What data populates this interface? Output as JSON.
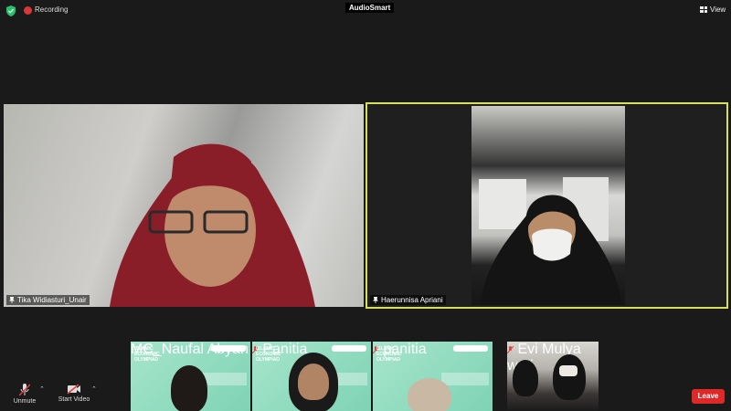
{
  "topbar": {
    "recording_label": "Recording",
    "title": "AudioSmart",
    "view_label": "View"
  },
  "colors": {
    "active_speaker_border": "#d7e05a",
    "recording_dot": "#d93838",
    "leave_button": "#e02828",
    "shield": "#27c26a"
  },
  "participants": {
    "main": [
      {
        "name": "Tika Widiasturi_Unair",
        "muted": false
      },
      {
        "name": "Haerunnisa Apriani",
        "muted": false,
        "active_speaker": true
      }
    ],
    "strip": [
      {
        "name": "MC_Naufal Abyan",
        "muted": false
      },
      {
        "name": "Panitia",
        "muted": true
      },
      {
        "name": "panitia",
        "muted": true
      },
      {
        "name": "Evi Mulya wati",
        "muted": true
      }
    ]
  },
  "slide": {
    "title_lines": [
      "ISLAMIC",
      "ECONOMIC",
      "OLYMPIAD"
    ]
  },
  "controls": {
    "unmute_label": "Unmute",
    "start_video_label": "Start Video",
    "leave_label": "Leave"
  },
  "icons": {
    "security": "shield-icon",
    "recording": "record-dot-icon",
    "view": "grid-view-icon",
    "mic": "mic-muted-icon",
    "video": "video-off-icon",
    "pin": "pin-icon"
  }
}
